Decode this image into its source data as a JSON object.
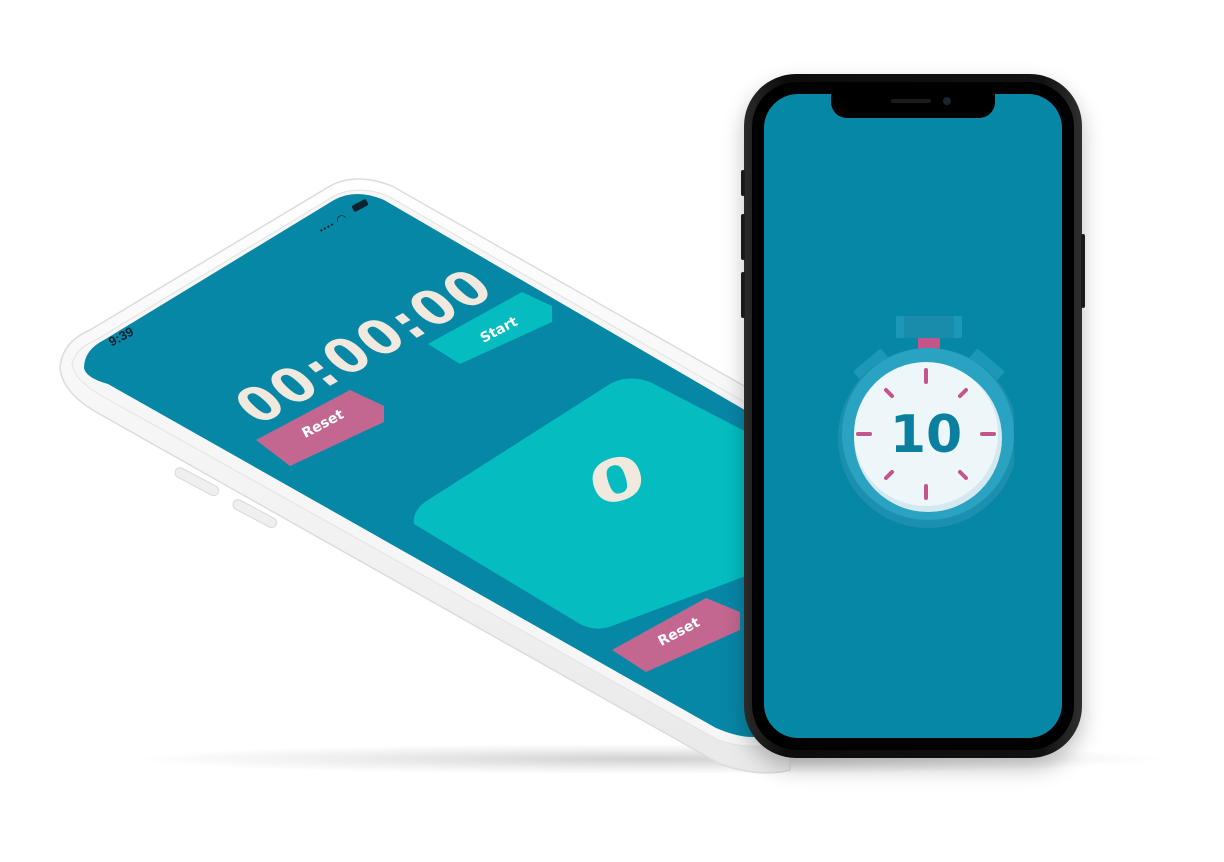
{
  "tilted_phone": {
    "status_time": "9:39",
    "timer_display": "00:00:00",
    "start_label": "Start",
    "top_reset_label": "Reset",
    "counter_value": "0",
    "bottom_reset_label": "Reset"
  },
  "upright_phone": {
    "stopwatch_number": "10"
  },
  "colors": {
    "screen_bg": "#0787a6",
    "accent_teal": "#05bdc1",
    "reset_pink": "#c46790",
    "digit_cream": "#f1e8de",
    "stopwatch_face": "#e8f3f7",
    "stopwatch_tick": "#c3558a"
  },
  "icons": {
    "wifi": "wifi-icon",
    "battery": "battery-icon",
    "signal": "signal-icon",
    "stopwatch": "stopwatch-icon"
  }
}
